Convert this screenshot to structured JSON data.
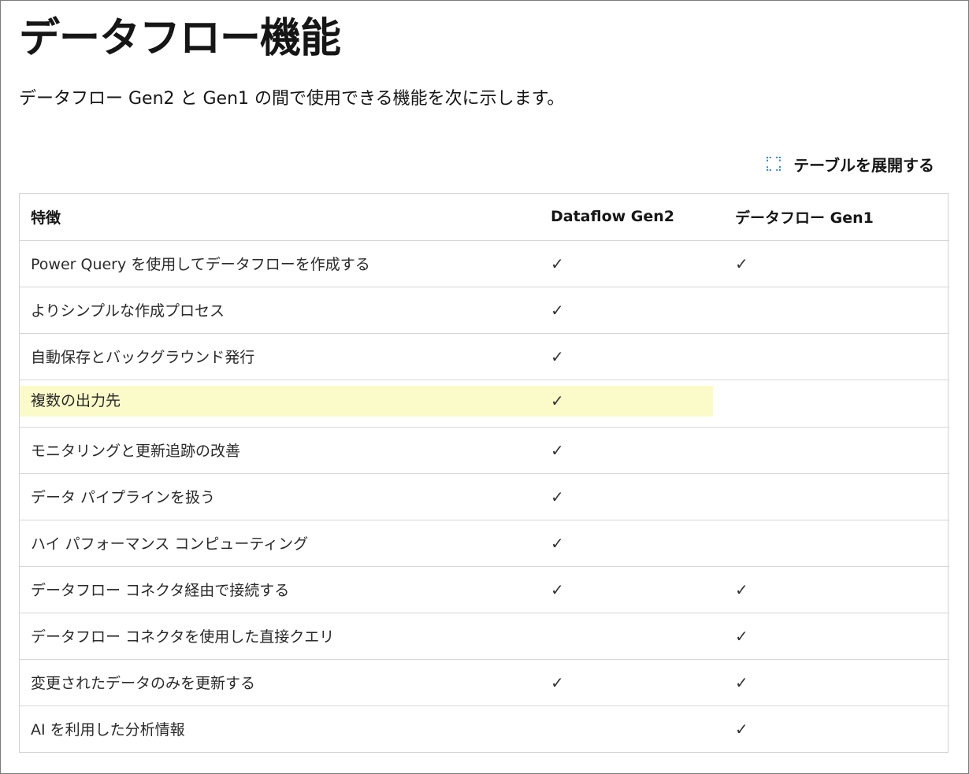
{
  "page": {
    "title": "データフロー機能",
    "intro": "データフロー Gen2 と Gen1 の間で使用できる機能を次に示します。",
    "expand_label": "テーブルを展開する"
  },
  "table": {
    "headers": [
      "特徴",
      "Dataflow Gen2",
      "データフロー Gen1"
    ],
    "check_mark": "✓",
    "highlight_color": "#fbfbc9",
    "rows": [
      {
        "feature": "Power Query を使用してデータフローを作成する",
        "gen2": "✓",
        "gen1": "✓"
      },
      {
        "feature": "よりシンプルな作成プロセス",
        "gen2": "✓",
        "gen1": ""
      },
      {
        "feature": "自動保存とバックグラウンド発行",
        "gen2": "✓",
        "gen1": ""
      },
      {
        "feature": "複数の出力先",
        "gen2": "✓",
        "gen1": "",
        "highlighted": true
      },
      {
        "feature": "モニタリングと更新追跡の改善",
        "gen2": "✓",
        "gen1": ""
      },
      {
        "feature": "データ パイプラインを扱う",
        "gen2": "✓",
        "gen1": ""
      },
      {
        "feature": "ハイ パフォーマンス コンピューティング",
        "gen2": "✓",
        "gen1": ""
      },
      {
        "feature": "データフロー コネクタ経由で接続する",
        "gen2": "✓",
        "gen1": "✓"
      },
      {
        "feature": "データフロー コネクタを使用した直接クエリ",
        "gen2": "",
        "gen1": "✓"
      },
      {
        "feature": "変更されたデータのみを更新する",
        "gen2": "✓",
        "gen1": "✓"
      },
      {
        "feature": "AI を利用した分析情報",
        "gen2": "",
        "gen1": "✓"
      }
    ]
  },
  "icons": {
    "expand": "expand-icon"
  }
}
